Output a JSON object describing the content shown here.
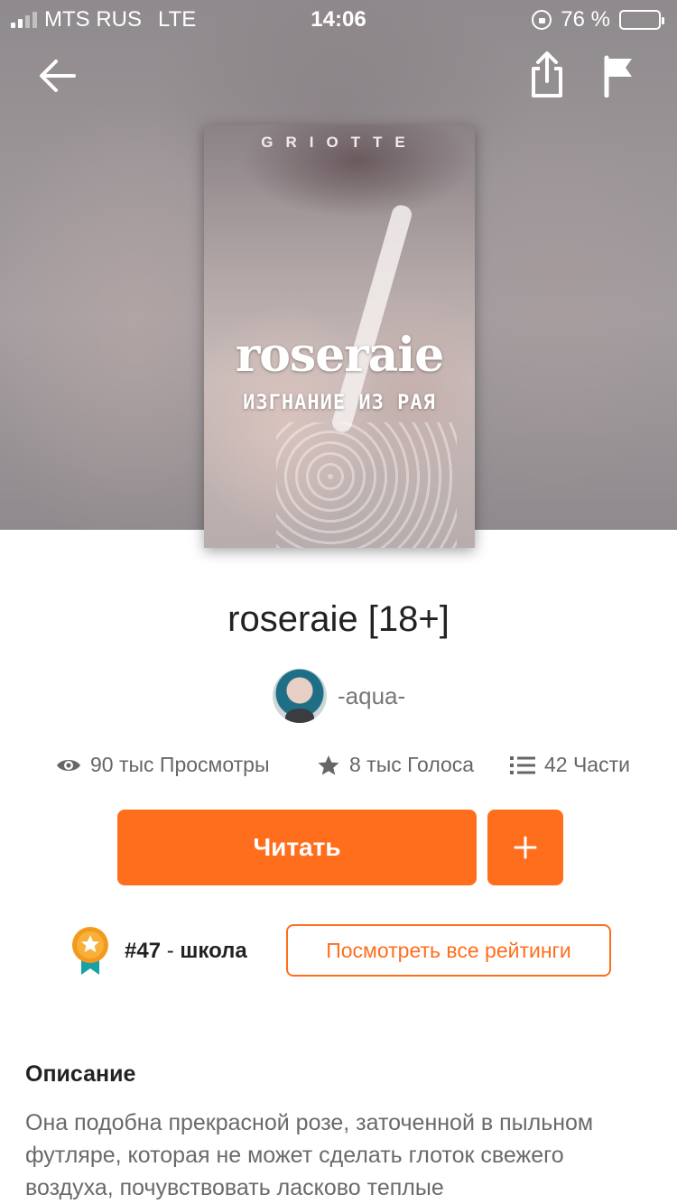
{
  "status_bar": {
    "carrier": "MTS RUS",
    "network": "LTE",
    "time": "14:06",
    "battery": "76 %",
    "battery_level": 0.76,
    "signal_bars": 2
  },
  "nav": {
    "back_icon": "arrow-left-icon",
    "share_icon": "share-icon",
    "report_icon": "flag-icon"
  },
  "cover": {
    "author_mark": "GRIOTTE",
    "title": "roseraie",
    "subtitle": "ИЗГНАНИЕ ИЗ РАЯ"
  },
  "story": {
    "title": "roseraie [18+]",
    "author": "-aqua-"
  },
  "stats": {
    "views": "90 тыс Просмотры",
    "votes": "8 тыс Голоса",
    "parts": "42 Части"
  },
  "actions": {
    "read_label": "Читать",
    "add_label": "+"
  },
  "ranking": {
    "rank": "#47",
    "separator": " - ",
    "tag": "школа",
    "view_all_label": "Посмотреть все рейтинги"
  },
  "description": {
    "heading": "Описание",
    "text": "Она подобна прекрасной розе, заточенной в пыльном футляре, которая не может сделать глоток свежего воздуха, почувствовать ласково теплые"
  },
  "colors": {
    "accent": "#ff6e1d",
    "badge_orange": "#f39a1c",
    "badge_ribbon": "#1aa0a6"
  }
}
